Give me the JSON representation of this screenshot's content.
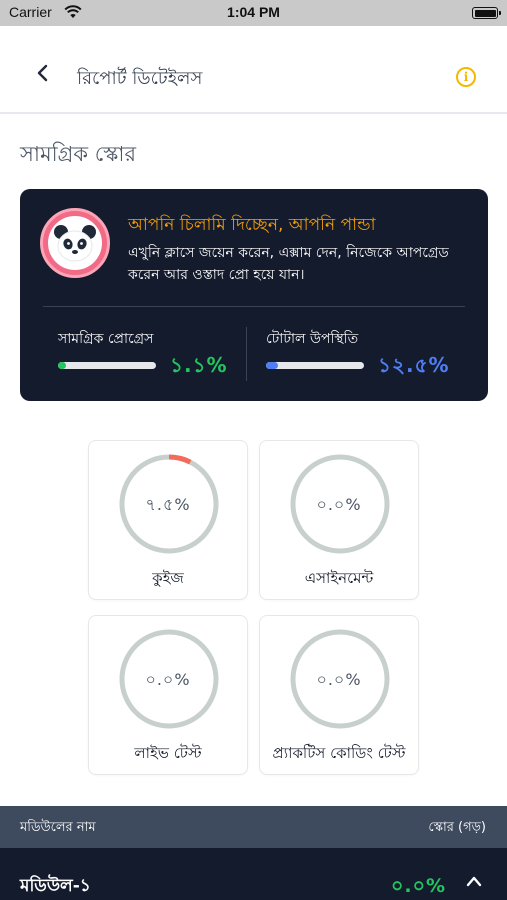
{
  "status_bar": {
    "carrier": "Carrier",
    "time": "1:04 PM"
  },
  "header": {
    "title": "রিপোর্ট ডিটেইলস",
    "info_icon": "i"
  },
  "section_title": "সামগ্রিক স্কোর",
  "summary_card": {
    "headline": "আপনি চিলামি দিচ্ছেন, আপনি পান্ডা",
    "description": "এখুনি ক্লাসে জয়েন করেন, এক্সাম দেন, নিজেকে আপগ্রেড করেন আর ওস্তাদ প্রো হয়ে যান।",
    "progress": {
      "label": "সামগ্রিক প্রোগ্রেস",
      "value": "১.১%",
      "fraction": 0.011,
      "color": "#22c55e"
    },
    "attendance": {
      "label": "টোটাল উপস্থিতি",
      "value": "১২.৫%",
      "fraction": 0.125,
      "color": "#4f7df3"
    }
  },
  "tiles": [
    {
      "percent_text": "৭.৫%",
      "fraction": 0.075,
      "label": "কুইজ"
    },
    {
      "percent_text": "০.০%",
      "fraction": 0,
      "label": "এসাইনমেন্ট"
    },
    {
      "percent_text": "০.০%",
      "fraction": 0,
      "label": "লাইভ টেস্ট"
    },
    {
      "percent_text": "০.০%",
      "fraction": 0,
      "label": "প্র্যাকটিস কোডিং টেস্ট"
    }
  ],
  "colors": {
    "ring_track": "#c8d0ce",
    "ring_progress": "#f26b5b"
  },
  "table": {
    "col_module": "মডিউলের নাম",
    "col_score": "স্কোর (গড়)"
  },
  "modules": [
    {
      "name": "মডিউল-১",
      "score": "০.০%"
    }
  ]
}
